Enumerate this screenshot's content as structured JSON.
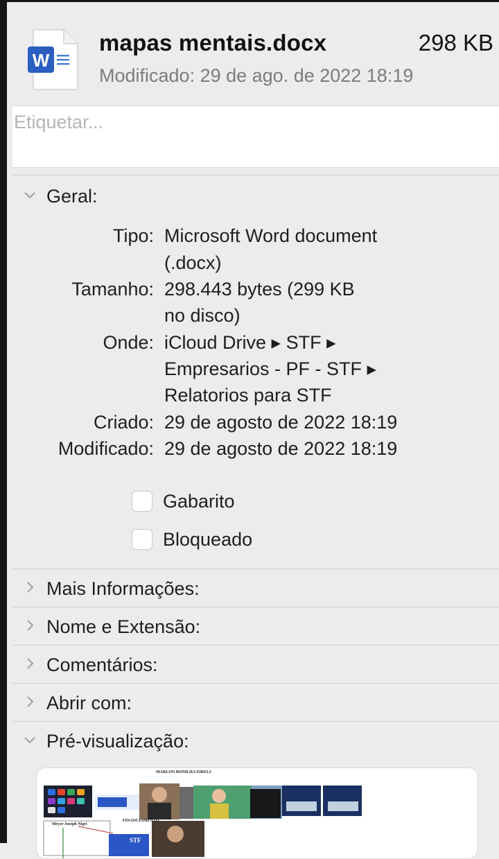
{
  "header": {
    "file_name": "mapas mentais.docx",
    "file_size": "298 KB",
    "modified_line": "Modificado: 29 de ago. de 2022 18:19",
    "icon": "word-document-icon",
    "icon_letter": "W"
  },
  "tags": {
    "placeholder": "Etiquetar..."
  },
  "general": {
    "title": "Geral:",
    "expanded": true,
    "rows": [
      {
        "label": "Tipo:",
        "lines": [
          "Microsoft Word document",
          "(.docx)"
        ]
      },
      {
        "label": "Tamanho:",
        "lines": [
          "298.443 bytes (299 KB",
          "no disco)"
        ]
      },
      {
        "label": "Onde:",
        "lines": [
          "iCloud Drive ▸ STF ▸",
          "Empresarios - PF - STF ▸",
          "Relatorios para STF"
        ]
      },
      {
        "label": "Criado:",
        "lines": [
          "29 de agosto de 2022 18:19"
        ]
      },
      {
        "label": "Modificado:",
        "lines": [
          "29 de agosto de 2022 18:19"
        ]
      }
    ],
    "checkboxes": [
      {
        "label": "Gabarito",
        "checked": false
      },
      {
        "label": "Bloqueado",
        "checked": false
      }
    ]
  },
  "sections": [
    {
      "title": "Mais Informações:",
      "expanded": false
    },
    {
      "title": "Nome e Extensão:",
      "expanded": false
    },
    {
      "title": "Comentários:",
      "expanded": false
    },
    {
      "title": "Abrir com:",
      "expanded": false
    },
    {
      "title": "Pré-visualização:",
      "expanded": true
    }
  ],
  "preview": {
    "doc_title": "MARLON BONILHA EIRELI",
    "left_caption": "Meyer Joseph Nigri",
    "right_caption": "FINANCIAMENTO",
    "badge_text": "STF"
  },
  "colors": {
    "word_blue": "#2b5fbf",
    "background": "#ececec",
    "divider": "#d0d0d0",
    "secondary_text": "#7c7c7c"
  }
}
